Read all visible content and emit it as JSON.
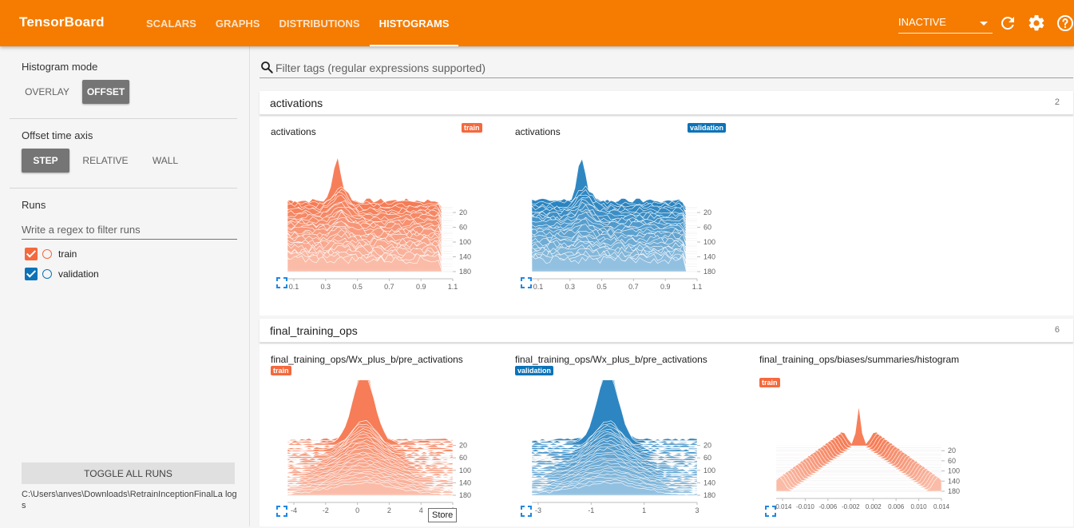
{
  "app": {
    "title": "TensorBoard",
    "tabs": [
      {
        "label": "SCALARS",
        "active": false
      },
      {
        "label": "GRAPHS",
        "active": false
      },
      {
        "label": "DISTRIBUTIONS",
        "active": false
      },
      {
        "label": "HISTOGRAMS",
        "active": true
      }
    ],
    "reload_status": "INACTIVE",
    "toolbar_icons": [
      "refresh-icon",
      "settings-gear-icon",
      "help-icon"
    ],
    "accent_color": "#f57c00"
  },
  "sidebar": {
    "histogram_mode": {
      "title": "Histogram mode",
      "options": [
        "OVERLAY",
        "OFFSET"
      ],
      "selected": "OFFSET"
    },
    "offset_time_axis": {
      "title": "Offset time axis",
      "options": [
        "STEP",
        "RELATIVE",
        "WALL"
      ],
      "selected": "STEP"
    },
    "runs": {
      "title": "Runs",
      "filter_placeholder": "Write a regex to filter runs",
      "items": [
        {
          "name": "train",
          "checked": true,
          "color": "#f4693d"
        },
        {
          "name": "validation",
          "checked": true,
          "color": "#0c73b8"
        }
      ],
      "toggle_all_label": "TOGGLE ALL RUNS",
      "logdir": "C:\\Users\\anves\\Downloads\\RetrainInceptionFinalLa logs"
    }
  },
  "main": {
    "filter_placeholder": "Filter tags (regular expressions supported)",
    "categories": [
      {
        "name": "activations",
        "count": "2",
        "cards": [
          {
            "title": "activations",
            "run": "train",
            "color": "#f4693d",
            "x_ticks": [
              "0.1",
              "0.3",
              "0.5",
              "0.7",
              "0.9",
              "1.1"
            ],
            "y_ticks": [
              "20",
              "60",
              "100",
              "140",
              "180"
            ]
          },
          {
            "title": "activations",
            "run": "validation",
            "color": "#0c73b8",
            "x_ticks": [
              "0.1",
              "0.3",
              "0.5",
              "0.7",
              "0.9",
              "1.1"
            ],
            "y_ticks": [
              "20",
              "60",
              "100",
              "140",
              "180"
            ]
          }
        ]
      },
      {
        "name": "final_training_ops",
        "count": "6",
        "cards": [
          {
            "title": "final_training_ops/Wx_plus_b/pre_activations",
            "run": "train",
            "color": "#f4693d",
            "x_ticks": [
              "-4",
              "-2",
              "0",
              "2",
              "4",
              "6"
            ],
            "y_ticks": [
              "20",
              "60",
              "100",
              "140",
              "180"
            ]
          },
          {
            "title": "final_training_ops/Wx_plus_b/pre_activations",
            "run": "validation",
            "color": "#0c73b8",
            "x_ticks": [
              "-3",
              "-1",
              "1",
              "3"
            ],
            "y_ticks": [
              "20",
              "60",
              "100",
              "140",
              "180"
            ]
          },
          {
            "title": "final_training_ops/biases/summaries/histogram",
            "run": "train",
            "color": "#f4693d",
            "x_ticks": [
              "-0.014",
              "-0.010",
              "-0.006",
              "-0.002",
              "0.002",
              "0.006",
              "0.010",
              "0.014"
            ],
            "y_ticks": [
              "20",
              "60",
              "100",
              "140",
              "180"
            ]
          }
        ]
      }
    ]
  },
  "tooltip": "Store"
}
